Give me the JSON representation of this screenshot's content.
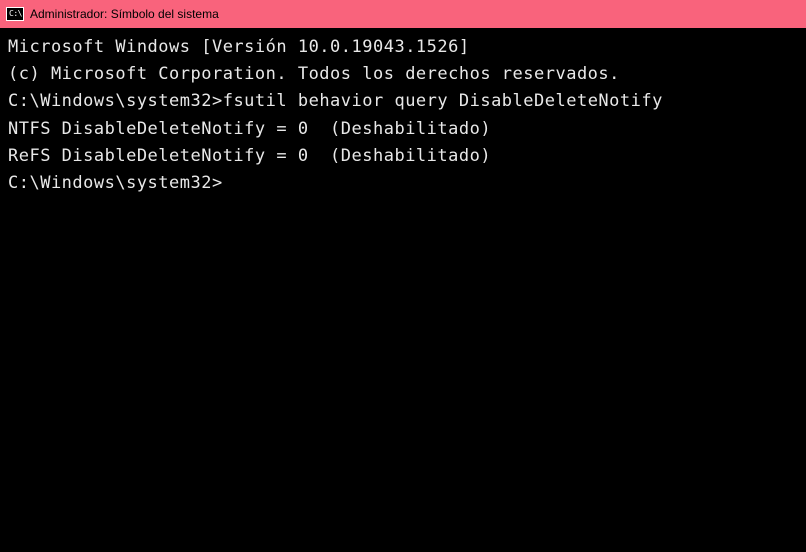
{
  "window": {
    "title": "Administrador: Símbolo del sistema",
    "icon_text": "C:\\"
  },
  "terminal": {
    "line_version": "Microsoft Windows [Versión 10.0.19043.1526]",
    "line_copyright": "(c) Microsoft Corporation. Todos los derechos reservados.",
    "blank1": "",
    "prompt1_path": "C:\\Windows\\system32>",
    "prompt1_cmd": "fsutil behavior query DisableDeleteNotify",
    "output_ntfs": "NTFS DisableDeleteNotify = 0  (Deshabilitado)",
    "output_refs": "ReFS DisableDeleteNotify = 0  (Deshabilitado)",
    "blank2": "",
    "prompt2_path": "C:\\Windows\\system32>"
  }
}
